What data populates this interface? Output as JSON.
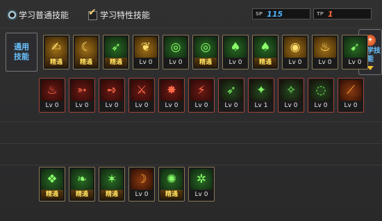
{
  "tabs": {
    "normal_label": "学习普通技能",
    "special_label": "学习特性技能"
  },
  "counters": {
    "sp_label": "SP",
    "sp_value": "115",
    "tp_label": "TP",
    "tp_value": "1"
  },
  "side_label": "通用技能",
  "right_button": {
    "icon": "skill-book-icon",
    "label": "偏学技能"
  },
  "row1": [
    {
      "icon": "reading-icon",
      "level": "精通",
      "mastered": true,
      "color": "yellow"
    },
    {
      "icon": "crescent-slash-icon",
      "level": "精通",
      "mastered": true,
      "color": "yellow"
    },
    {
      "icon": "leap-icon",
      "level": "精通",
      "mastered": true,
      "color": "green"
    },
    {
      "icon": "wings-icon",
      "level": "Lv 0",
      "mastered": false,
      "color": "yellow"
    },
    {
      "icon": "target-icon",
      "level": "Lv 0",
      "mastered": false,
      "color": "green"
    },
    {
      "icon": "target-icon",
      "level": "精通",
      "mastered": true,
      "color": "green"
    },
    {
      "icon": "mushroom-icon",
      "level": "Lv 0",
      "mastered": false,
      "color": "green"
    },
    {
      "icon": "mushroom-icon",
      "level": "精通",
      "mastered": true,
      "color": "green"
    },
    {
      "icon": "eye-icon",
      "level": "Lv 0",
      "mastered": false,
      "color": "yellow"
    },
    {
      "icon": "power-up-icon",
      "level": "Lv 0",
      "mastered": false,
      "color": "yellow"
    },
    {
      "icon": "dash-icon",
      "level": "Lv 0",
      "mastered": false,
      "color": "green"
    }
  ],
  "row2": [
    {
      "icon": "flame-slash-icon",
      "level": "Lv 0",
      "color": "redart"
    },
    {
      "icon": "dragon-icon",
      "level": "Lv 0",
      "color": "redart"
    },
    {
      "icon": "runner-icon",
      "level": "Lv 0",
      "color": "redart"
    },
    {
      "icon": "claw-icon",
      "level": "Lv 0",
      "color": "redart"
    },
    {
      "icon": "fire-dash-icon",
      "level": "Lv 0",
      "color": "redart"
    },
    {
      "icon": "blade-icon",
      "level": "Lv 0",
      "color": "redart"
    },
    {
      "icon": "green-runner-icon",
      "level": "Lv 0",
      "color": "greenred"
    },
    {
      "icon": "spikes-icon",
      "level": "Lv 1",
      "color": "greenred"
    },
    {
      "icon": "burst-icon",
      "level": "Lv 0",
      "color": "greenred"
    },
    {
      "icon": "ring-icon",
      "level": "Lv 0",
      "color": "greenred"
    },
    {
      "icon": "strike-icon",
      "level": "Lv 0",
      "color": "orange"
    }
  ],
  "row3": [
    {
      "icon": "crystal-icon",
      "level": "精通",
      "mastered": true,
      "color": "green"
    },
    {
      "icon": "vine-icon",
      "level": "精通",
      "mastered": true,
      "color": "green"
    },
    {
      "icon": "sparkle-icon",
      "level": "精通",
      "mastered": true,
      "color": "green"
    },
    {
      "icon": "moon-icon",
      "level": "Lv 0",
      "mastered": false,
      "color": "orange"
    },
    {
      "icon": "explosion-icon",
      "level": "精通",
      "mastered": true,
      "color": "green"
    },
    {
      "icon": "stars-icon",
      "level": "Lv 0",
      "mastered": false,
      "color": "green"
    }
  ]
}
